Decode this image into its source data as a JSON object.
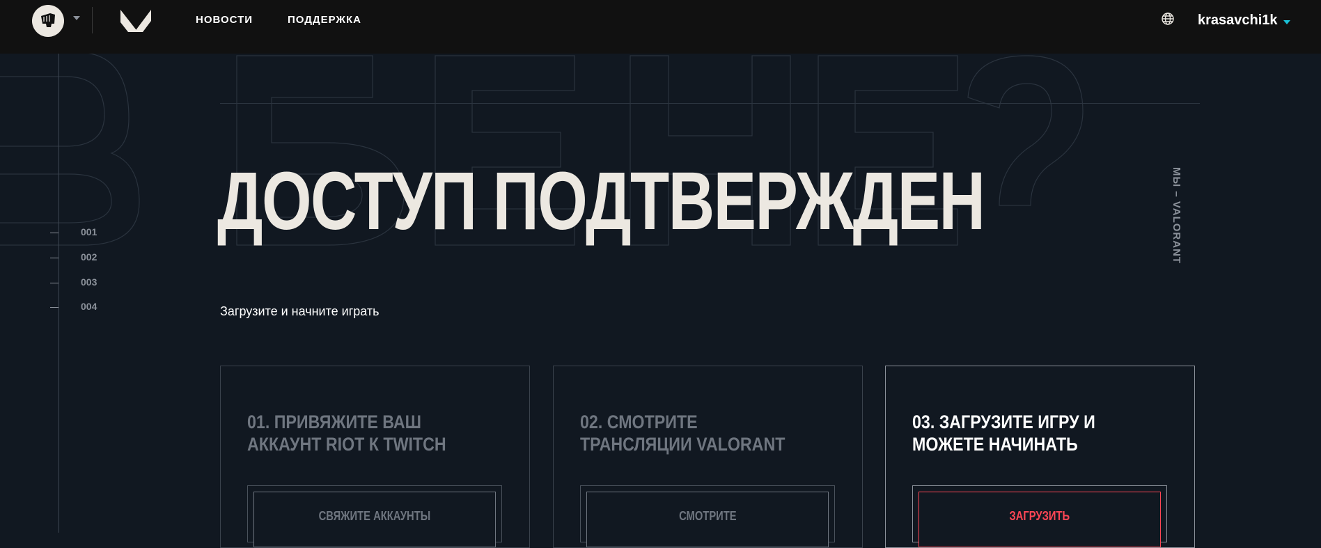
{
  "header": {
    "nav": [
      {
        "label": "НОВОСТИ"
      },
      {
        "label": "ПОДДЕРЖКА"
      }
    ],
    "username": "krasavchi1k",
    "icons": {
      "riot": "riot-fist-logo",
      "valorant": "valorant-logo",
      "language": "globe-icon"
    }
  },
  "sidebar": {
    "index": [
      "001",
      "002",
      "003",
      "004"
    ],
    "side_label": "МЫ – VALORANT"
  },
  "hero": {
    "title": "ДОСТУП ПОДТВЕРЖДЕН",
    "subtitle": "Загрузите и начните играть"
  },
  "steps": [
    {
      "title": "01. ПРИВЯЖИТЕ ВАШ АККАУНТ RIOT К TWITCH",
      "button": "СВЯЖИТЕ АККАУНТЫ",
      "active": false
    },
    {
      "title": "02. СМОТРИТЕ ТРАНСЛЯЦИИ VALORANT",
      "button": "СМОТРИТЕ",
      "active": false
    },
    {
      "title": "03. ЗАГРУЗИТЕ ИГРУ И МОЖЕТЕ НАЧИНАТЬ",
      "button": "ЗАГРУЗИТЬ",
      "active": true
    }
  ],
  "colors": {
    "background": "#111821",
    "topbar": "#111111",
    "accent": "#ff4655",
    "text": "#ece8e1",
    "muted": "#6f7680"
  }
}
